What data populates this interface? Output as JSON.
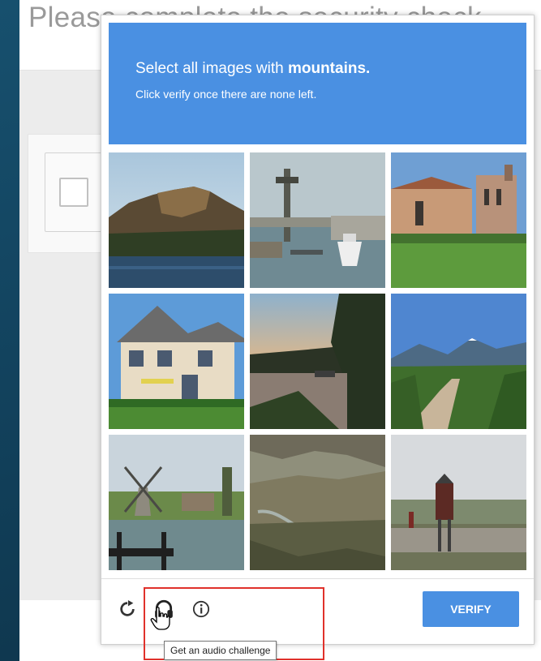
{
  "background_page": {
    "title": "Please complete the security check"
  },
  "challenge": {
    "title_prefix": "Select all images with ",
    "title_keyword": "mountains.",
    "subtitle": "Click verify once there are none left.",
    "accent_color": "#4a90e2",
    "tiles": [
      {
        "subject": "mountain over lake"
      },
      {
        "subject": "harbor with tower and boat"
      },
      {
        "subject": "brick church building"
      },
      {
        "subject": "two-storey house"
      },
      {
        "subject": "sunset river"
      },
      {
        "subject": "mountains with dirt road"
      },
      {
        "subject": "windmill by water"
      },
      {
        "subject": "mountain valley with river"
      },
      {
        "subject": "sign by stone wall"
      }
    ]
  },
  "footer": {
    "reload_icon": "reload-icon",
    "audio_icon": "headphones-icon",
    "info_icon": "info-icon",
    "verify_label": "VERIFY"
  },
  "tooltip": {
    "text": "Get an audio challenge"
  },
  "annotation": {
    "highlight_color": "#e0312b"
  }
}
